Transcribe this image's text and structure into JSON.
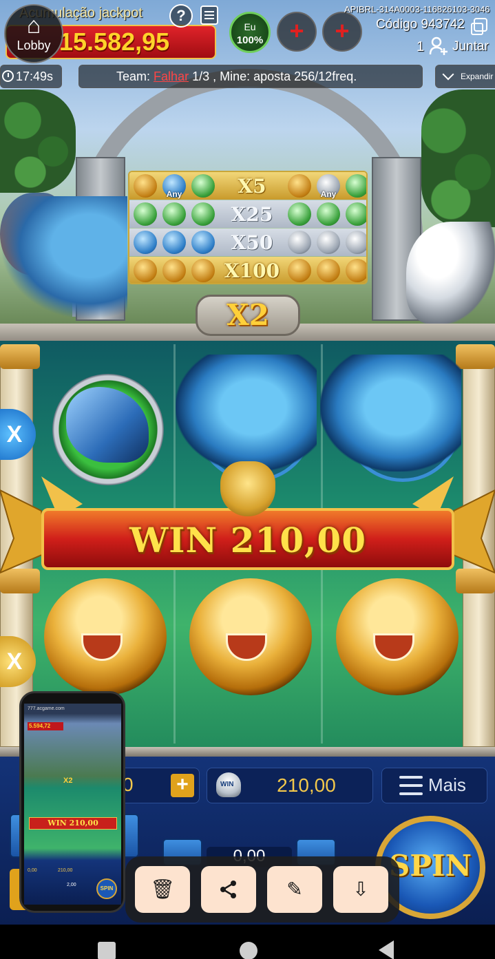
{
  "hud": {
    "jackpot_label": "Acumulação jackpot",
    "jackpot_value": "15.582,95",
    "lobby_label": "Lobby",
    "help_glyph": "?",
    "player_name": "Eu",
    "player_percent": "100%",
    "add_seat_glyph": "+",
    "api_code": "APIBRL-314A0003-116826103-3046",
    "room_code": "Código 943742",
    "players_count": "1",
    "join_label": "Juntar"
  },
  "infobar": {
    "timer": "17:49s",
    "team_prefix": "Team:",
    "team_status": "Falhar",
    "team_suffix": "1/3 , Mine: aposta 256/12freq.",
    "expand_label": "Expandir"
  },
  "paytable": {
    "any_label": "Any",
    "rows": [
      {
        "multiplier": "X5"
      },
      {
        "multiplier": "X25"
      },
      {
        "multiplier": "X50"
      },
      {
        "multiplier": "X100"
      }
    ]
  },
  "game": {
    "multiplier": "X2",
    "win_banner": "WIN 210,00",
    "side_button_label": "X"
  },
  "panel": {
    "bet_value": "0",
    "bet_plus": "+",
    "win_icon_label": "WIN",
    "win_value": "210,00",
    "more_label": "Mais",
    "spin_label": "SPIN",
    "bet_display": "0,00"
  },
  "pip": {
    "url": "777.acgame.com",
    "jackpot": "5.594,72",
    "multiplier": "X2",
    "win_banner": "WIN 210,00",
    "bet": "0,00",
    "win": "210,00",
    "bet_amount": "2,00",
    "spin": "SPIN"
  },
  "toolbar": {
    "delete_glyph": "🗑",
    "share_glyph": "⤴",
    "edit_glyph": "✎",
    "save_glyph": "⇩"
  },
  "colors": {
    "jackpot_red": "#d01f1a",
    "gold": "#f3c84b",
    "panel_blue": "#0c2258",
    "fail_red": "#ff4545"
  }
}
